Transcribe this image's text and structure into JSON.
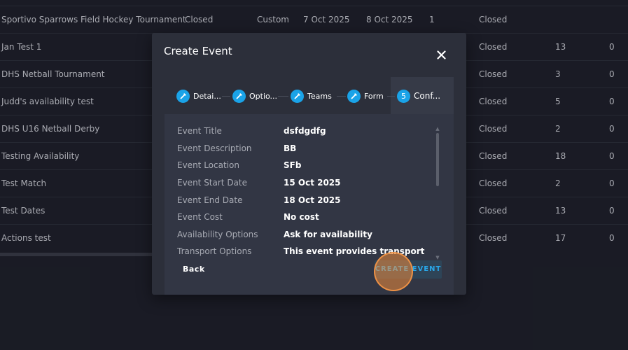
{
  "background_table": {
    "rows": [
      {
        "name": "Sportivo Sparrows Field Hockey Tournament",
        "status": "Closed",
        "type": "Custom",
        "start": "7 Oct 2025",
        "end": "8 Oct 2025",
        "n1": "1",
        "status2": "Closed",
        "n2": "",
        "n3": ""
      },
      {
        "name": "Jan Test 1",
        "status": "",
        "type": "",
        "start": "",
        "end": "",
        "n1": "",
        "status2": "Closed",
        "n2": "13",
        "n3": "0"
      },
      {
        "name": "DHS Netball Tournament",
        "status": "",
        "type": "",
        "start": "",
        "end": "",
        "n1": "",
        "status2": "Closed",
        "n2": "3",
        "n3": "0"
      },
      {
        "name": "Judd's availability test",
        "status": "",
        "type": "",
        "start": "",
        "end": "",
        "n1": "",
        "status2": "Closed",
        "n2": "5",
        "n3": "0"
      },
      {
        "name": "DHS U16 Netball Derby",
        "status": "",
        "type": "",
        "start": "",
        "end": "",
        "n1": "",
        "status2": "Closed",
        "n2": "2",
        "n3": "0"
      },
      {
        "name": "Testing Availability",
        "status": "",
        "type": "",
        "start": "",
        "end": "",
        "n1": "",
        "status2": "Closed",
        "n2": "18",
        "n3": "0"
      },
      {
        "name": "Test Match",
        "status": "",
        "type": "",
        "start": "",
        "end": "",
        "n1": "",
        "status2": "Closed",
        "n2": "2",
        "n3": "0"
      },
      {
        "name": "Test Dates",
        "status": "",
        "type": "",
        "start": "",
        "end": "",
        "n1": "",
        "status2": "Closed",
        "n2": "13",
        "n3": "0"
      },
      {
        "name": "Actions test",
        "status": "",
        "type": "",
        "start": "",
        "end": "",
        "n1": "",
        "status2": "Closed",
        "n2": "17",
        "n3": "0"
      }
    ]
  },
  "modal": {
    "title": "Create Event",
    "close_icon": "close-icon",
    "steps": [
      {
        "label": "Detai...",
        "icon": "pencil-icon"
      },
      {
        "label": "Optio...",
        "icon": "pencil-icon"
      },
      {
        "label": "Teams",
        "icon": "pencil-icon"
      },
      {
        "label": "Form",
        "icon": "pencil-icon"
      },
      {
        "label": "Conf...",
        "number": "5"
      }
    ],
    "details": [
      {
        "label": "Event Title",
        "value": "dsfdgdfg"
      },
      {
        "label": "Event Description",
        "value": "BB"
      },
      {
        "label": "Event Location",
        "value": "SFb"
      },
      {
        "label": "Event Start Date",
        "value": "15 Oct 2025"
      },
      {
        "label": "Event End Date",
        "value": "18 Oct 2025"
      },
      {
        "label": "Event Cost",
        "value": "No cost"
      },
      {
        "label": "Availability Options",
        "value": "Ask for availability"
      },
      {
        "label": "Transport Options",
        "value": "This event provides transport"
      }
    ],
    "back_label": "Back",
    "create_label": "CREATE EVENT"
  },
  "colors": {
    "accent": "#1aa3e8",
    "background": "#1f212b",
    "modal": "#2c2f3a",
    "click_indicator": "#f08c3c"
  }
}
